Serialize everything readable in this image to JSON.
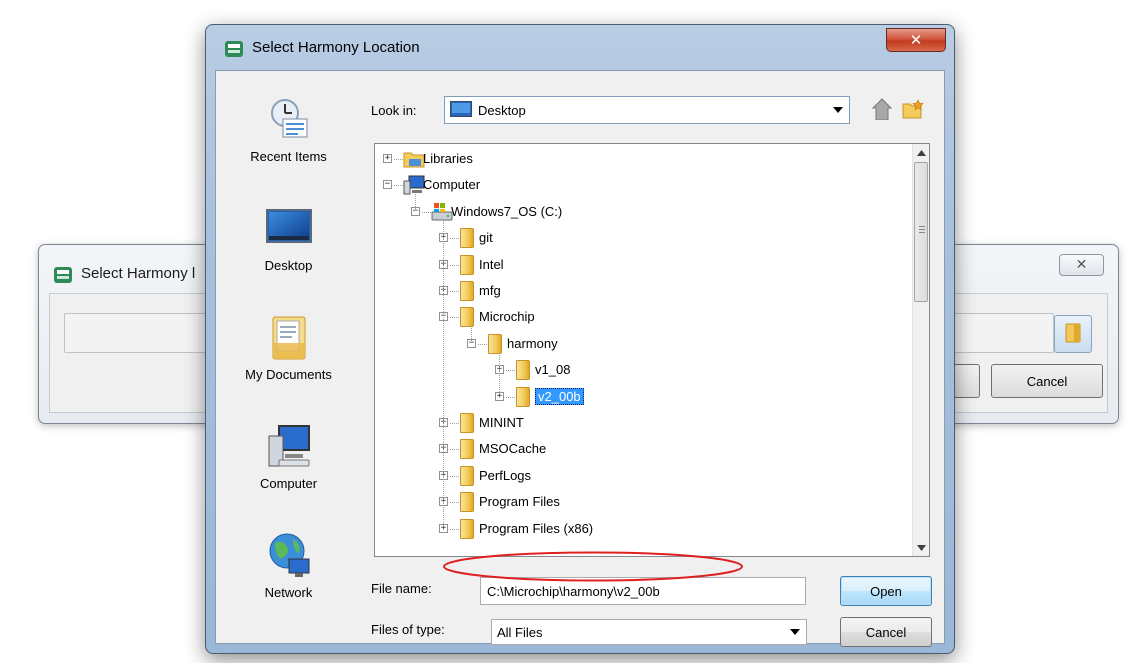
{
  "background_dialog": {
    "title": "Select Harmony l",
    "close_glyph": "✕",
    "path_value": "",
    "cancel_label": "Cancel",
    "browse_icon": "folder-icon"
  },
  "dialog": {
    "title": "Select Harmony Location",
    "close_glyph": "✕",
    "app_icon": "harmony-icon"
  },
  "places": [
    {
      "label": "Recent Items",
      "icon": "recent-items-icon"
    },
    {
      "label": "Desktop",
      "icon": "desktop-icon"
    },
    {
      "label": "My Documents",
      "icon": "my-documents-icon"
    },
    {
      "label": "Computer",
      "icon": "computer-icon"
    },
    {
      "label": "Network",
      "icon": "network-icon"
    }
  ],
  "look_in": {
    "label": "Look in:",
    "value": "Desktop",
    "up_icon": "up-folder-icon",
    "new_folder_icon": "new-folder-icon"
  },
  "tree": [
    {
      "label": "Libraries",
      "level": 0,
      "expander": "+",
      "icon": "libraries-icon"
    },
    {
      "label": "Computer",
      "level": 0,
      "expander": "−",
      "icon": "computer-icon"
    },
    {
      "label": "Windows7_OS (C:)",
      "level": 1,
      "expander": "−",
      "icon": "drive-icon"
    },
    {
      "label": "git",
      "level": 2,
      "expander": "+",
      "icon": "folder-icon"
    },
    {
      "label": "Intel",
      "level": 2,
      "expander": "+",
      "icon": "folder-icon"
    },
    {
      "label": "mfg",
      "level": 2,
      "expander": "+",
      "icon": "folder-icon"
    },
    {
      "label": "Microchip",
      "level": 2,
      "expander": "−",
      "icon": "folder-icon"
    },
    {
      "label": "harmony",
      "level": 3,
      "expander": "−",
      "icon": "folder-icon"
    },
    {
      "label": "v1_08",
      "level": 4,
      "expander": "+",
      "icon": "folder-icon"
    },
    {
      "label": "v2_00b",
      "level": 4,
      "expander": "+",
      "icon": "folder-icon",
      "selected": true
    },
    {
      "label": "MININT",
      "level": 2,
      "expander": "+",
      "icon": "folder-icon"
    },
    {
      "label": "MSOCache",
      "level": 2,
      "expander": "+",
      "icon": "folder-icon"
    },
    {
      "label": "PerfLogs",
      "level": 2,
      "expander": "+",
      "icon": "folder-icon"
    },
    {
      "label": "Program Files",
      "level": 2,
      "expander": "+",
      "icon": "folder-icon"
    },
    {
      "label": "Program Files (x86)",
      "level": 2,
      "expander": "+",
      "icon": "folder-icon"
    }
  ],
  "file_name": {
    "label": "File name:",
    "value": "C:\\Microchip\\harmony\\v2_00b"
  },
  "files_of_type": {
    "label": "Files of type:",
    "value": "All Files"
  },
  "buttons": {
    "open": "Open",
    "cancel": "Cancel"
  },
  "colors": {
    "selection": "#3399ff",
    "annotation": "#e02020"
  }
}
